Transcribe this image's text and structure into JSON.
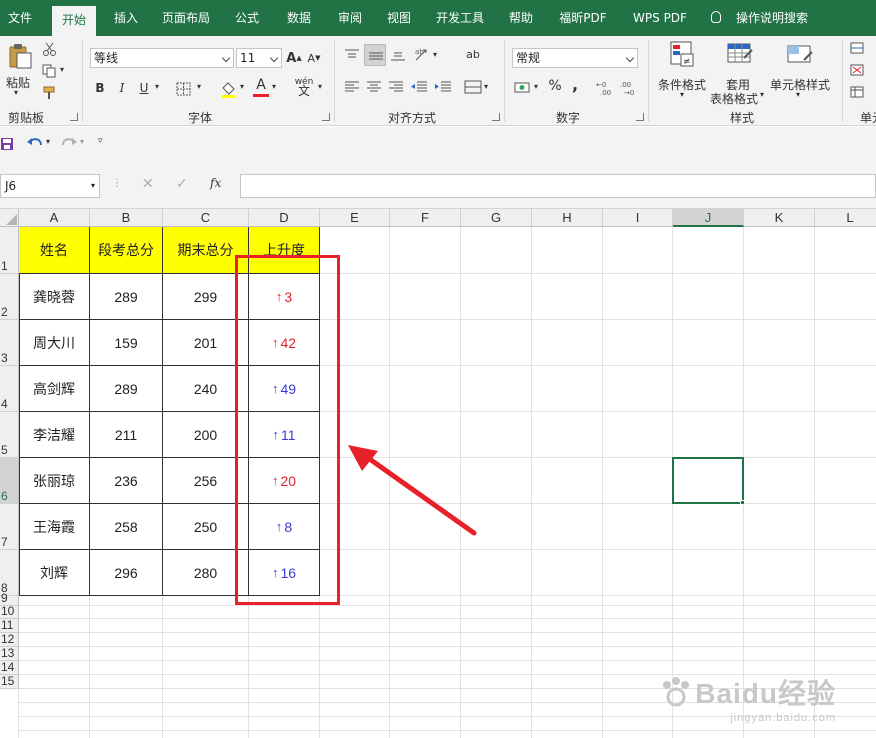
{
  "menubar": {
    "tabs": [
      {
        "id": "file",
        "label": "文件"
      },
      {
        "id": "home",
        "label": "开始",
        "active": true
      },
      {
        "id": "insert",
        "label": "插入"
      },
      {
        "id": "page-layout",
        "label": "页面布局"
      },
      {
        "id": "formulas",
        "label": "公式"
      },
      {
        "id": "data",
        "label": "数据"
      },
      {
        "id": "review",
        "label": "审阅"
      },
      {
        "id": "view",
        "label": "视图"
      },
      {
        "id": "developer",
        "label": "开发工具"
      },
      {
        "id": "help",
        "label": "帮助"
      },
      {
        "id": "foxit-pdf",
        "label": "福昕PDF"
      },
      {
        "id": "wps-pdf",
        "label": "WPS PDF"
      }
    ],
    "tell_me": "操作说明搜索"
  },
  "ribbon": {
    "clipboard": {
      "label": "剪贴板",
      "paste": "粘贴"
    },
    "font": {
      "label": "字体",
      "font_name": "等线",
      "font_size": "11",
      "bold": "B",
      "italic": "I",
      "underline": "U",
      "grow": "A",
      "shrink": "A",
      "font_color": "A",
      "phonetic": "wén"
    },
    "alignment": {
      "label": "对齐方式",
      "wrap": "ab"
    },
    "number": {
      "label": "数字",
      "format": "常规",
      "percent": "%",
      "comma": ","
    },
    "styles": {
      "label": "样式",
      "conditional": "条件格式",
      "table_line1": "套用",
      "table_line2": "表格格式",
      "cell_styles": "单元格样式"
    },
    "cells": {
      "label": "单元"
    }
  },
  "namebox": {
    "value": "J6"
  },
  "formula": {
    "fx": "fx",
    "value": ""
  },
  "sheet": {
    "columns": [
      "A",
      "B",
      "C",
      "D",
      "E",
      "F",
      "G",
      "H",
      "I",
      "J",
      "K",
      "L"
    ],
    "selected_column": "J",
    "selected_row": "6",
    "selected_cell": "J6",
    "row_labels": [
      "1",
      "2",
      "3",
      "4",
      "5",
      "6",
      "7",
      "8",
      "9",
      "10",
      "11",
      "12",
      "13",
      "14",
      "15"
    ],
    "table": {
      "headers": [
        "姓名",
        "段考总分",
        "期末总分",
        "上升度"
      ],
      "rows": [
        {
          "name": "龚晓蓉",
          "exam1": "289",
          "exam2": "299",
          "rise": "3",
          "color": "#e8202a"
        },
        {
          "name": "周大川",
          "exam1": "159",
          "exam2": "201",
          "rise": "42",
          "color": "#e8202a"
        },
        {
          "name": "高剑辉",
          "exam1": "289",
          "exam2": "240",
          "rise": "49",
          "color": "#3b3bd6"
        },
        {
          "name": "李洁耀",
          "exam1": "211",
          "exam2": "200",
          "rise": "11",
          "color": "#3b3bd6"
        },
        {
          "name": "张丽琼",
          "exam1": "236",
          "exam2": "256",
          "rise": "20",
          "color": "#e8202a"
        },
        {
          "name": "王海霞",
          "exam1": "258",
          "exam2": "250",
          "rise": "8",
          "color": "#3b3bd6"
        },
        {
          "name": "刘辉",
          "exam1": "296",
          "exam2": "280",
          "rise": "16",
          "color": "#3b3bd6"
        }
      ],
      "arrow_glyph": "↑"
    }
  },
  "annotation": {
    "color": "#e8202a"
  },
  "watermark": {
    "brand": "Baidu经验",
    "url": "jingyan.baidu.com"
  },
  "colors": {
    "accent": "#217346",
    "header_fill": "#ffff00"
  }
}
